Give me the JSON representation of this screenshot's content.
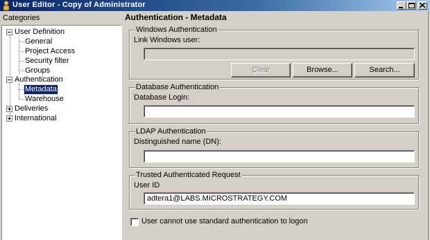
{
  "window": {
    "title": "User Editor - Copy of Administrator"
  },
  "categories": {
    "label": "Categories",
    "tree": [
      {
        "label": "User Definition",
        "expander": "−"
      },
      {
        "label": "General"
      },
      {
        "label": "Project Access"
      },
      {
        "label": "Security filter"
      },
      {
        "label": "Groups"
      },
      {
        "label": "Authentication",
        "expander": "−"
      },
      {
        "label": "Metadata"
      },
      {
        "label": "Warehouse"
      },
      {
        "label": "Deliveries",
        "expander": "+"
      },
      {
        "label": "International",
        "expander": "+"
      }
    ]
  },
  "page": {
    "title": "Authentication - Metadata"
  },
  "windows_auth": {
    "legend": "Windows Authentication",
    "field_label": "Link Windows user:",
    "value": "",
    "buttons": {
      "clear": "Clear",
      "browse": "Browse...",
      "search": "Search..."
    }
  },
  "database_auth": {
    "legend": "Database Authentication",
    "field_label": "Database Login:",
    "value": ""
  },
  "ldap_auth": {
    "legend": "LDAP Authentication",
    "field_label": "Distinguished name (DN):",
    "value": ""
  },
  "trusted_auth": {
    "legend": "Trusted Authenticated Request",
    "field_label": "User ID",
    "value": "adtera1@LABS.MICROSTRATEGY.COM"
  },
  "options": {
    "cannot_use_standard_label": "User cannot use standard authentication to logon",
    "cannot_use_standard_checked": false
  }
}
